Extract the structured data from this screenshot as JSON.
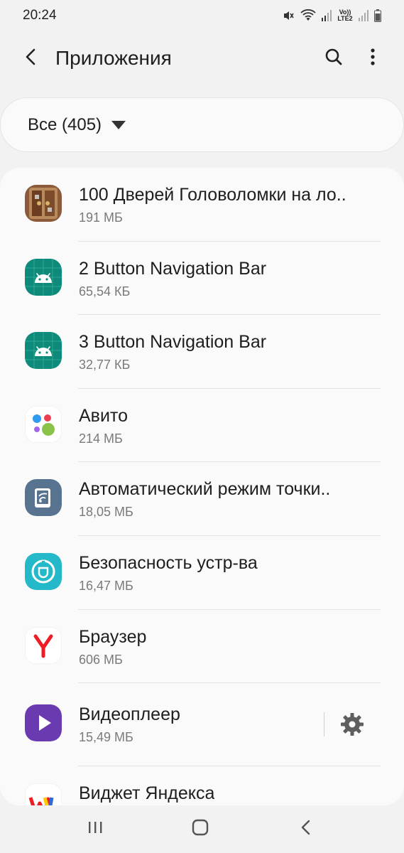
{
  "status_bar": {
    "time": "20:24",
    "icons": [
      "mute-icon",
      "wifi-icon",
      "signal-icon",
      "volte-lte2-icon",
      "signal-icon-2",
      "battery-icon"
    ],
    "volte_label": "Vo)) LTE2"
  },
  "header": {
    "title": "Приложения",
    "back_icon": "back-arrow-icon",
    "search_icon": "search-icon",
    "more_icon": "more-vert-icon"
  },
  "filter": {
    "label": "Все (405)",
    "caret_icon": "dropdown-caret-icon"
  },
  "apps": [
    {
      "name": "100 Дверей Головоломки на ло..",
      "size": "191 МБ",
      "icon": "doors-game-icon"
    },
    {
      "name": "2 Button Navigation Bar",
      "size": "65,54 КБ",
      "icon": "android-icon"
    },
    {
      "name": "3 Button Navigation Bar",
      "size": "32,77 КБ",
      "icon": "android-icon"
    },
    {
      "name": "Авито",
      "size": "214 МБ",
      "icon": "avito-icon"
    },
    {
      "name": "Автоматический режим точки..",
      "size": "18,05 МБ",
      "icon": "hotspot-icon"
    },
    {
      "name": "Безопасность устр-ва",
      "size": "16,47 МБ",
      "icon": "device-security-icon"
    },
    {
      "name": "Браузер",
      "size": "606 МБ",
      "icon": "yandex-browser-icon"
    },
    {
      "name": "Видеоплеер",
      "size": "15,49 МБ",
      "icon": "video-player-icon",
      "has_settings": true
    },
    {
      "name": "Виджет Яндекса",
      "size": "",
      "icon": "yandex-widget-icon"
    }
  ],
  "nav": {
    "recents_icon": "recents-icon",
    "home_icon": "home-icon",
    "back_icon": "nav-back-icon"
  },
  "colors": {
    "android_green": "#0e8a7a",
    "avito_blue": "#2f9bf0",
    "avito_green": "#8bc34a",
    "avito_purple": "#a267e6",
    "avito_red": "#ee3d50",
    "hotspot_slate": "#57738f",
    "security_cyan": "#23b9c9",
    "yandex_red": "#ee1c25",
    "video_purple": "#6a3bb0"
  }
}
